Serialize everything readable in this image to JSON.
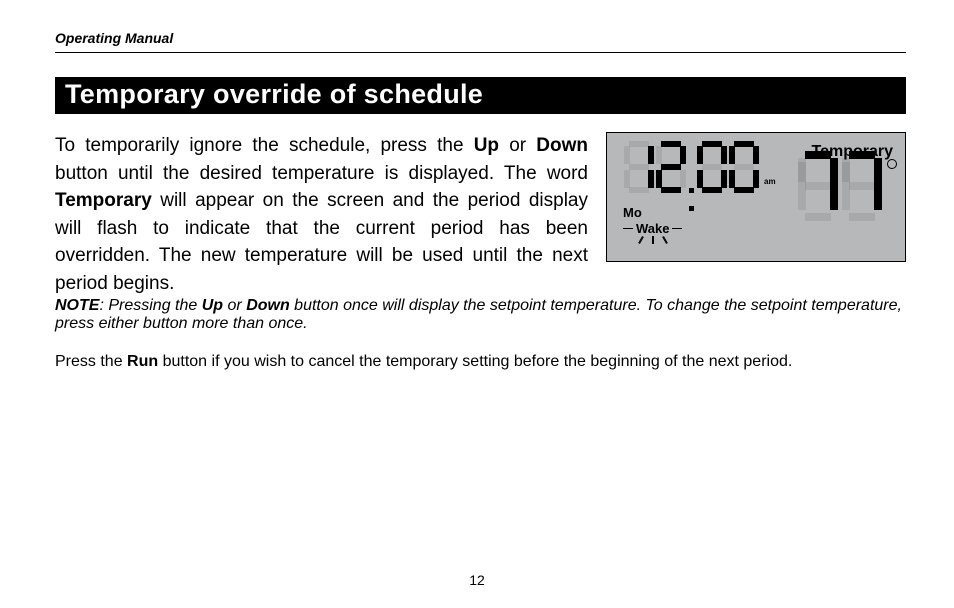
{
  "header": "Operating Manual",
  "section_title": "Temporary override of schedule",
  "paragraph1": {
    "pre": "To temporarily ignore the schedule, press the ",
    "bold1": "Up",
    "mid1": " or ",
    "bold2": "Down",
    "mid2": " button until the desired temperature is displayed. The word ",
    "bold3": "Temporary",
    "post": " will appear on the screen and the period display will flash to indicate that the current period has been overridden. The new temperature will be used until the next period begins."
  },
  "note": {
    "label": "NOTE",
    "pre": ": Pressing the ",
    "bold1": "Up",
    "mid1": " or ",
    "bold2": "Down",
    "post": " button once will display the setpoint temperature. To change the setpoint temperature, press either button more than once."
  },
  "paragraph3": {
    "pre": "Press the ",
    "bold1": "Run",
    "post": " button if you wish to cancel the temporary setting before the beginning of the next period."
  },
  "display": {
    "time": "12:00",
    "ampm": "am",
    "day": "Mo",
    "period": "Wake",
    "status": "Temporary",
    "temperature": "77"
  },
  "page_number": "12"
}
